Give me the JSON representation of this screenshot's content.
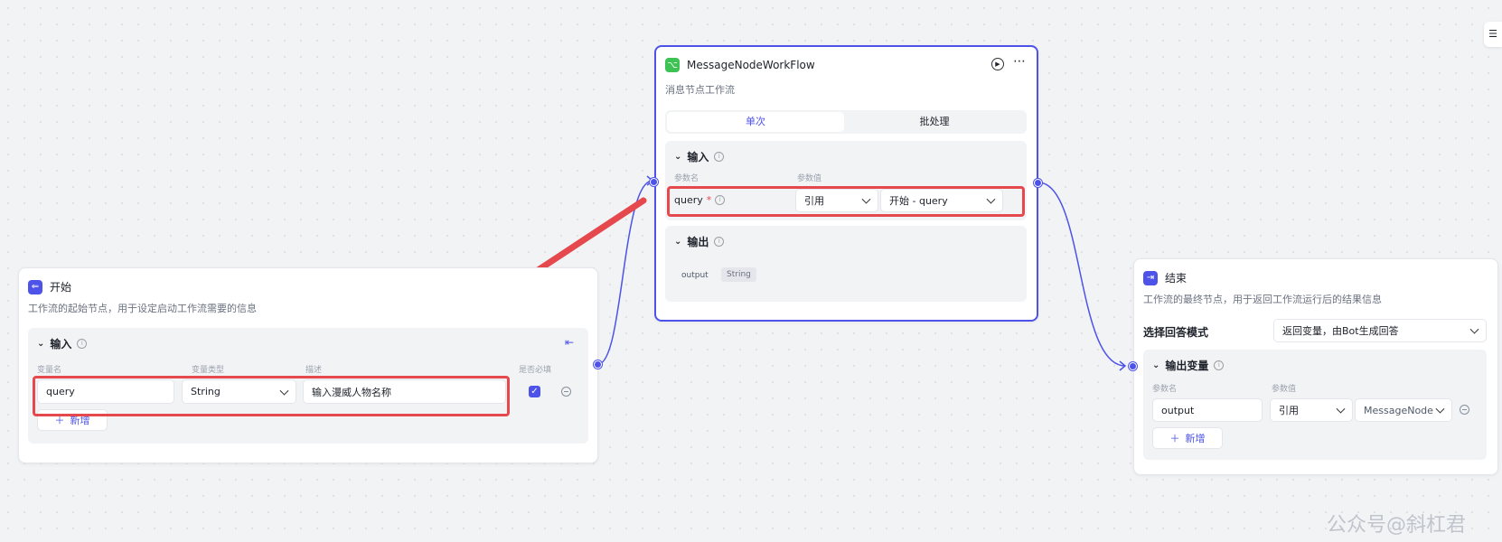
{
  "start_node": {
    "title": "开始",
    "description": "工作流的起始节点，用于设定启动工作流需要的信息",
    "input_section": {
      "title": "输入",
      "col_name": "变量名",
      "col_type": "变量类型",
      "col_desc": "描述",
      "col_required": "是否必填",
      "row": {
        "name": "query",
        "type": "String",
        "desc": "输入漫威人物名称"
      },
      "add_label": "新增"
    }
  },
  "workflow_node": {
    "title": "MessageNodeWorkFlow",
    "description": "消息节点工作流",
    "tab_single": "单次",
    "tab_batch": "批处理",
    "input_section": {
      "title": "输入",
      "col_param": "参数名",
      "col_value": "参数值",
      "param_name": "query",
      "required_mark": "*",
      "ref_mode": "引用",
      "ref_value": "开始 - query"
    },
    "output_section": {
      "title": "输出",
      "name": "output",
      "type": "String"
    }
  },
  "end_node": {
    "title": "结束",
    "description": "工作流的最终节点，用于返回工作流运行后的结果信息",
    "mode_label": "选择回答模式",
    "mode_value": "返回变量，由Bot生成回答",
    "output_section": {
      "title": "输出变量",
      "col_param": "参数名",
      "col_value": "参数值",
      "name": "output",
      "ref_mode": "引用",
      "ref_value": "MessageNode"
    },
    "add_label": "新增"
  },
  "watermark": "公众号@斜杠君",
  "colors": {
    "accent": "#4d53e8",
    "annotation": "#e5484d",
    "start_icon": "#4d53e8",
    "workflow_icon": "#3ec254"
  }
}
